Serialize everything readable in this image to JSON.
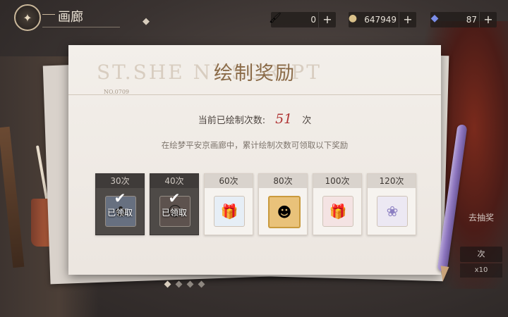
{
  "topbar": {
    "title": "画廊",
    "currencies": [
      {
        "icon": "paint-brush-icon",
        "value": "0"
      },
      {
        "icon": "coin-icon",
        "value": "647949"
      },
      {
        "icon": "gem-icon",
        "value": "87"
      }
    ]
  },
  "panel": {
    "title": "绘制奖励",
    "watermark": "ST.SHE    NUSCRIPT",
    "doc_no": "NO.0709",
    "count_label": "当前已绘制次数:",
    "count_value": "51",
    "count_unit": "次",
    "description": "在绘梦平安京画廊中，累计绘制次数可领取以下奖励"
  },
  "claimed_text": "已领取",
  "rewards": [
    {
      "label": "30次",
      "claimed": true,
      "icon": "token-icon"
    },
    {
      "label": "40次",
      "claimed": true,
      "icon": "portrait-icon"
    },
    {
      "label": "60次",
      "claimed": false,
      "icon": "blue-gift-box-icon"
    },
    {
      "label": "80次",
      "claimed": false,
      "icon": "avatar-frame-icon"
    },
    {
      "label": "100次",
      "claimed": false,
      "icon": "pink-gift-box-icon"
    },
    {
      "label": "120次",
      "claimed": false,
      "icon": "fan-ornament-icon"
    }
  ],
  "background": {
    "side_label": "去抽奖",
    "side_count": "次",
    "side_multiplier": "x10"
  },
  "pager": {
    "pages": 4,
    "active": 0
  }
}
